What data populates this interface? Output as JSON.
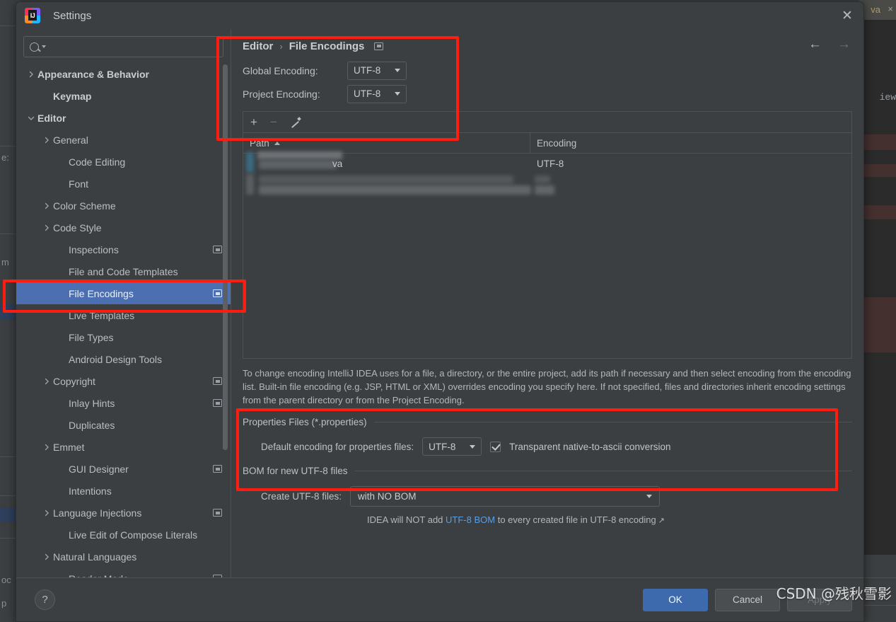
{
  "window": {
    "title": "Settings",
    "logo_icon": "intellij-idea-logo",
    "close_icon": "close-icon"
  },
  "search": {
    "value": "",
    "placeholder": "",
    "icon": "search-icon",
    "dropdown_icon": "chevron-down-icon"
  },
  "sidebar": {
    "items": [
      {
        "label": "Appearance & Behavior",
        "indent": 0,
        "expandable": true,
        "expanded": false,
        "bold": true,
        "selected": false,
        "scope_icon": false
      },
      {
        "label": "Keymap",
        "indent": 1,
        "expandable": false,
        "expanded": false,
        "bold": true,
        "selected": false,
        "scope_icon": false
      },
      {
        "label": "Editor",
        "indent": 0,
        "expandable": true,
        "expanded": true,
        "bold": true,
        "selected": false,
        "scope_icon": false
      },
      {
        "label": "General",
        "indent": 1,
        "expandable": true,
        "expanded": false,
        "bold": false,
        "selected": false,
        "scope_icon": false
      },
      {
        "label": "Code Editing",
        "indent": 2,
        "expandable": false,
        "expanded": false,
        "bold": false,
        "selected": false,
        "scope_icon": false
      },
      {
        "label": "Font",
        "indent": 2,
        "expandable": false,
        "expanded": false,
        "bold": false,
        "selected": false,
        "scope_icon": false
      },
      {
        "label": "Color Scheme",
        "indent": 1,
        "expandable": true,
        "expanded": false,
        "bold": false,
        "selected": false,
        "scope_icon": false
      },
      {
        "label": "Code Style",
        "indent": 1,
        "expandable": true,
        "expanded": false,
        "bold": false,
        "selected": false,
        "scope_icon": false
      },
      {
        "label": "Inspections",
        "indent": 2,
        "expandable": false,
        "expanded": false,
        "bold": false,
        "selected": false,
        "scope_icon": true
      },
      {
        "label": "File and Code Templates",
        "indent": 2,
        "expandable": false,
        "expanded": false,
        "bold": false,
        "selected": false,
        "scope_icon": false
      },
      {
        "label": "File Encodings",
        "indent": 2,
        "expandable": false,
        "expanded": false,
        "bold": false,
        "selected": true,
        "scope_icon": true
      },
      {
        "label": "Live Templates",
        "indent": 2,
        "expandable": false,
        "expanded": false,
        "bold": false,
        "selected": false,
        "scope_icon": false
      },
      {
        "label": "File Types",
        "indent": 2,
        "expandable": false,
        "expanded": false,
        "bold": false,
        "selected": false,
        "scope_icon": false
      },
      {
        "label": "Android Design Tools",
        "indent": 2,
        "expandable": false,
        "expanded": false,
        "bold": false,
        "selected": false,
        "scope_icon": false
      },
      {
        "label": "Copyright",
        "indent": 1,
        "expandable": true,
        "expanded": false,
        "bold": false,
        "selected": false,
        "scope_icon": true
      },
      {
        "label": "Inlay Hints",
        "indent": 2,
        "expandable": false,
        "expanded": false,
        "bold": false,
        "selected": false,
        "scope_icon": true
      },
      {
        "label": "Duplicates",
        "indent": 2,
        "expandable": false,
        "expanded": false,
        "bold": false,
        "selected": false,
        "scope_icon": false
      },
      {
        "label": "Emmet",
        "indent": 1,
        "expandable": true,
        "expanded": false,
        "bold": false,
        "selected": false,
        "scope_icon": false
      },
      {
        "label": "GUI Designer",
        "indent": 2,
        "expandable": false,
        "expanded": false,
        "bold": false,
        "selected": false,
        "scope_icon": true
      },
      {
        "label": "Intentions",
        "indent": 2,
        "expandable": false,
        "expanded": false,
        "bold": false,
        "selected": false,
        "scope_icon": false
      },
      {
        "label": "Language Injections",
        "indent": 1,
        "expandable": true,
        "expanded": false,
        "bold": false,
        "selected": false,
        "scope_icon": true
      },
      {
        "label": "Live Edit of Compose Literals",
        "indent": 2,
        "expandable": false,
        "expanded": false,
        "bold": false,
        "selected": false,
        "scope_icon": false
      },
      {
        "label": "Natural Languages",
        "indent": 1,
        "expandable": true,
        "expanded": false,
        "bold": false,
        "selected": false,
        "scope_icon": false
      },
      {
        "label": "Reader Mode",
        "indent": 2,
        "expandable": false,
        "expanded": false,
        "bold": false,
        "selected": false,
        "scope_icon": true
      }
    ]
  },
  "main": {
    "breadcrumb": {
      "parent": "Editor",
      "separator": "›",
      "current": "File Encodings",
      "scope_icon": "project-scope-icon"
    },
    "nav": {
      "back_icon": "arrow-left-icon",
      "forward_icon": "arrow-right-icon"
    },
    "global_encoding": {
      "label": "Global Encoding:",
      "value": "UTF-8"
    },
    "project_encoding": {
      "label": "Project Encoding:",
      "value": "UTF-8"
    },
    "toolbar": {
      "add_icon": "plus-icon",
      "remove_icon": "minus-icon",
      "edit_icon": "pencil-icon"
    },
    "table": {
      "columns": [
        "Path",
        "Encoding"
      ],
      "sort_column": "Path",
      "sort_direction": "asc",
      "rows": [
        {
          "path": "va",
          "path_blurred": true,
          "encoding": "UTF-8"
        },
        {
          "path": "",
          "path_blurred": true,
          "encoding": "",
          "encoding_blurred": true
        }
      ]
    },
    "description": "To change encoding IntelliJ IDEA uses for a file, a directory, or the entire project, add its path if necessary and then select encoding from the encoding list. Built-in file encoding (e.g. JSP, HTML or XML) overrides encoding you specify here. If not specified, files and directories inherit encoding settings from the parent directory or from the Project Encoding.",
    "properties_group": {
      "title": "Properties Files (*.properties)",
      "default_encoding_label": "Default encoding for properties files:",
      "default_encoding_value": "UTF-8",
      "transparent_label": "Transparent native-to-ascii conversion",
      "transparent_checked": true
    },
    "bom_group": {
      "title": "BOM for new UTF-8 files",
      "create_label": "Create UTF-8 files:",
      "create_value": "with NO BOM",
      "hint_prefix": "IDEA will NOT add ",
      "hint_link": "UTF-8 BOM",
      "hint_suffix": " to every created file in UTF-8 encoding",
      "external_link_icon": "external-link-icon"
    }
  },
  "footer": {
    "help_label": "?",
    "ok_label": "OK",
    "cancel_label": "Cancel",
    "apply_label": "Apply"
  },
  "annotations": {
    "highlight_color": "#fe1d0e",
    "watermark": "CSDN @残秋雪影"
  },
  "background": {
    "tab_label": "va",
    "preview_label": "iew"
  }
}
